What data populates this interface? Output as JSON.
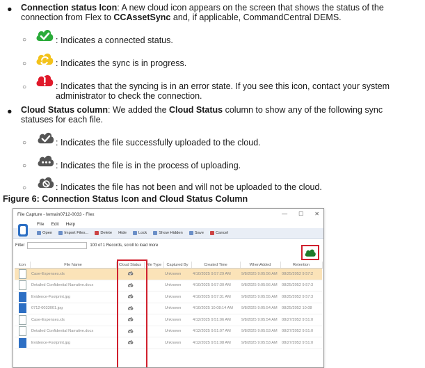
{
  "section1": {
    "label": "Connection status Icon",
    "text_a": ": A new cloud icon appears on the screen that shows the status of the connection from Flex to ",
    "brand": "CCAssetSync",
    "text_b": " and, if applicable, CommandCentral DEMS.",
    "items": [
      {
        "icon": "cloud-check-green-icon",
        "color": "#2bab3a",
        "text": ": Indicates a connected status."
      },
      {
        "icon": "cloud-sync-yellow-icon",
        "color": "#f3c21a",
        "text": ": Indicates the sync is in progress."
      },
      {
        "icon": "cloud-error-red-icon",
        "color": "#e0192a",
        "text": ": Indicates that the syncing is in an error state. If you see this icon, contact your system administrator to check the connection."
      }
    ]
  },
  "section2": {
    "label": "Cloud Status column",
    "text_a": ": We added the ",
    "bold": "Cloud Status",
    "text_b": " column to show any of the following sync statuses for each file.",
    "items": [
      {
        "icon": "cloud-check-gray-icon",
        "color": "#555555",
        "text": ": Indicates the file successfully uploaded to the cloud."
      },
      {
        "icon": "cloud-uploading-gray-icon",
        "color": "#555555",
        "text": ": Indicates the file is in the process of uploading."
      },
      {
        "icon": "cloud-blocked-gray-icon",
        "color": "#555555",
        "text": ": Indicates the file has not been and will not be uploaded to the cloud."
      }
    ]
  },
  "figure_caption": "Figure 6: Connection Status Icon and Cloud Status Column",
  "window": {
    "title": "File Capture - lwmain0712-0033 - Flex",
    "controls": [
      "—",
      "☐",
      "✕"
    ],
    "menu": [
      "File",
      "Edit",
      "Help"
    ],
    "toolbar": [
      "Open",
      "Import Files...",
      "Delete",
      "Hide",
      "Lock",
      "Show Hidden",
      "Save",
      "Cancel"
    ],
    "filter_label": "Filter",
    "records_text": "100 of 1 Records, scroll to load more",
    "columns": [
      "Icon",
      "File Name",
      "Cloud Status",
      "File Type",
      "Captured By",
      "Created Time",
      "WhenAdded",
      "Retention"
    ],
    "rows": [
      {
        "file": "Case-Expenses.xls",
        "type": "doc",
        "by": "Unknown",
        "created": "4/10/2025 9:57:29 AM",
        "added": "9/8/2025 9:05:56 AM",
        "ret": "08/25/2052 9:57:2",
        "selected": true
      },
      {
        "file": "Detailed Confidential Narrative.docx",
        "type": "doc",
        "by": "Unknown",
        "created": "4/10/2025 9:57:30 AM",
        "added": "9/8/2025 9:05:56 AM",
        "ret": "08/25/2052 9:57:3",
        "selected": false
      },
      {
        "file": "Evidence-Footprint.jpg",
        "type": "img",
        "by": "Unknown",
        "created": "4/10/2025 9:57:31 AM",
        "added": "9/8/2025 9:05:55 AM",
        "ret": "08/25/2052 9:57:3",
        "selected": false
      },
      {
        "file": "0712-0033001.jpg",
        "type": "img",
        "by": "Unknown",
        "created": "4/10/2025 10:08:14 AM",
        "added": "9/8/2025 9:05:54 AM",
        "ret": "08/25/2052 10:08",
        "selected": false
      },
      {
        "file": "Case-Expenses.xls",
        "type": "doc",
        "by": "Unknown",
        "created": "4/12/2025 9:51:06 AM",
        "added": "9/8/2025 9:05:54 AM",
        "ret": "08/27/2052 9:51:0",
        "selected": false
      },
      {
        "file": "Detailed Confidential Narrative.docx",
        "type": "doc",
        "by": "Unknown",
        "created": "4/12/2025 9:51:07 AM",
        "added": "9/8/2025 9:05:53 AM",
        "ret": "08/27/2052 9:51:0",
        "selected": false
      },
      {
        "file": "Evidence-Footprint.jpg",
        "type": "img",
        "by": "Unknown",
        "created": "4/12/2025 9:51:08 AM",
        "added": "9/8/2025 9:05:53 AM",
        "ret": "08/27/2052 9:51:0",
        "selected": false
      }
    ]
  }
}
